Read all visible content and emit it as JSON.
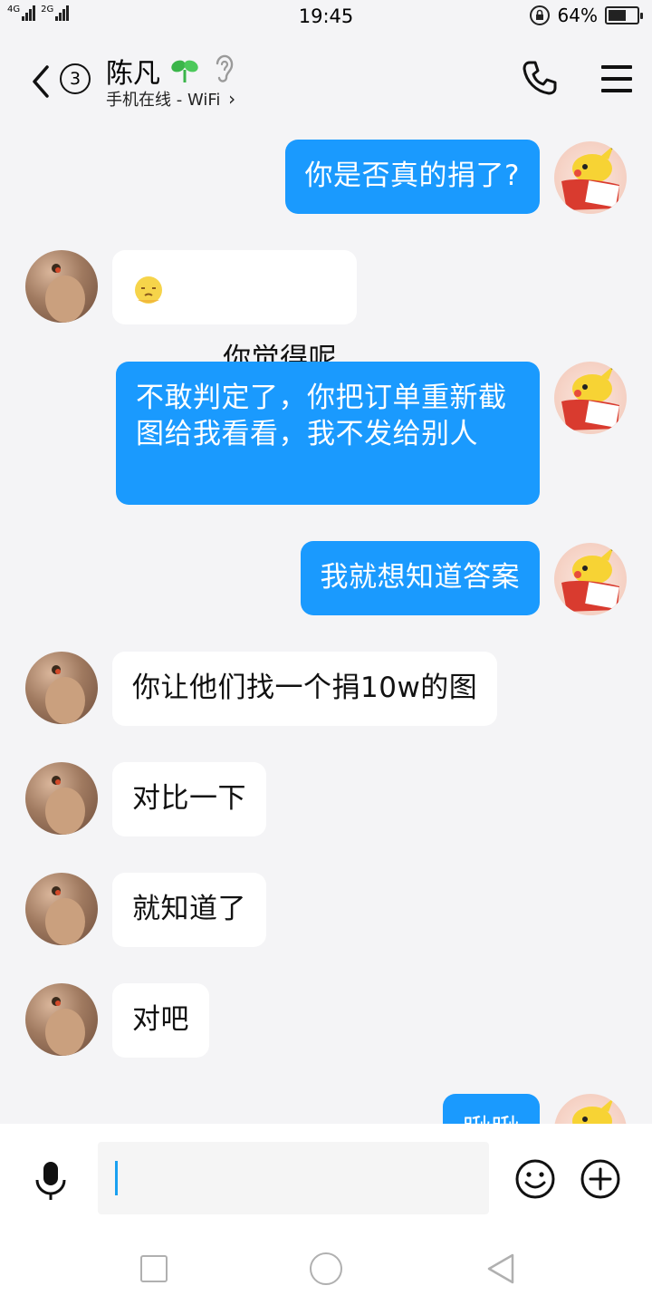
{
  "status_bar": {
    "net1": "4G",
    "net2": "2G",
    "time": "19:45",
    "battery": "64%",
    "battery_level": 0.64
  },
  "header": {
    "unread_count": "3",
    "contact_name": "陈凡",
    "contact_status": "手机在线 - WiFi",
    "status_chevron": "›",
    "icons": [
      "back-arrow-icon",
      "sprout-icon",
      "ear-icon",
      "phone-icon",
      "menu-icon"
    ]
  },
  "messages": [
    {
      "side": "out",
      "text": "你是否真的捐了?"
    },
    {
      "side": "in",
      "emoji": "emoji-face",
      "text": "你觉得呢"
    },
    {
      "side": "out",
      "text": "不敢判定了，你把订单重新截图给我看看，我不发给别人"
    },
    {
      "side": "out",
      "text": "我就想知道答案"
    },
    {
      "side": "in",
      "text": "你让他们找一个捐10w的图"
    },
    {
      "side": "in",
      "text": "对比一下"
    },
    {
      "side": "in",
      "text": "就知道了"
    },
    {
      "side": "in",
      "text": "对吧"
    },
    {
      "side": "out",
      "text": "瞅瞅"
    }
  ],
  "input_bar": {
    "input_value": "",
    "icons": [
      "microphone-icon",
      "smiley-icon",
      "plus-icon"
    ]
  },
  "nav_bar": {
    "icons": [
      "recent-apps-icon",
      "home-icon",
      "back-triangle-icon"
    ]
  }
}
